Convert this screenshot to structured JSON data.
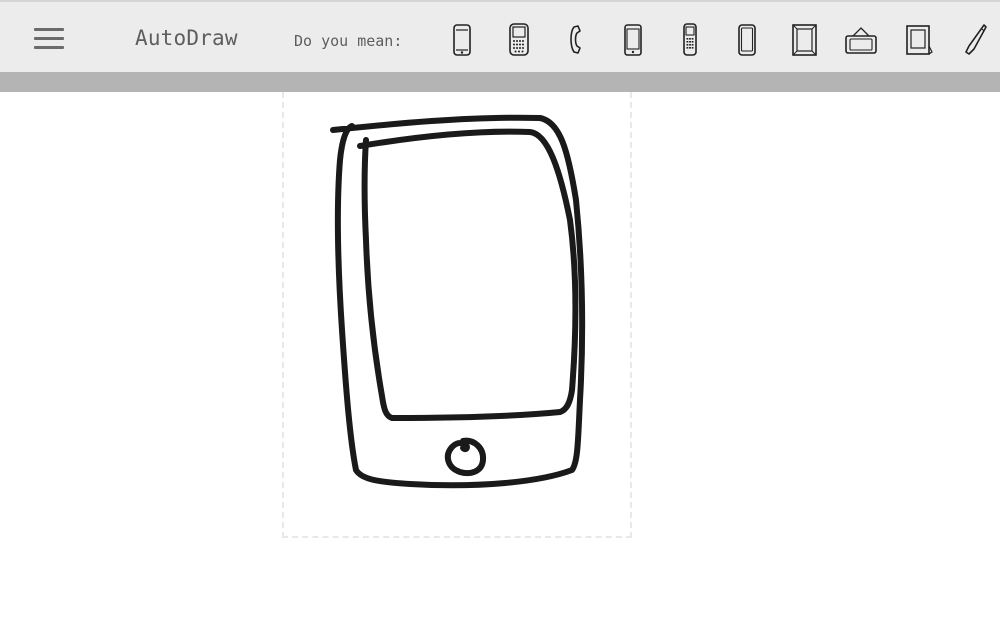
{
  "app": {
    "title": "AutoDraw"
  },
  "menu": {
    "icon": "hamburger-menu-icon"
  },
  "suggestions": {
    "label": "Do you mean:",
    "items": [
      {
        "icon": "smartphone-icon"
      },
      {
        "icon": "blackberry-phone-icon"
      },
      {
        "icon": "telephone-handset-icon"
      },
      {
        "icon": "smartphone-alt-icon"
      },
      {
        "icon": "keypad-phone-icon"
      },
      {
        "icon": "tablet-phone-icon"
      },
      {
        "icon": "picture-frame-icon"
      },
      {
        "icon": "hanging-frame-icon"
      },
      {
        "icon": "photo-frame-icon"
      },
      {
        "icon": "cordless-phone-icon"
      }
    ]
  },
  "colors": {
    "toolbar_bg": "#ececec",
    "subbar_bg": "#b4b4b4",
    "text": "#5e5e5e",
    "ink": "#1a1a1a"
  }
}
